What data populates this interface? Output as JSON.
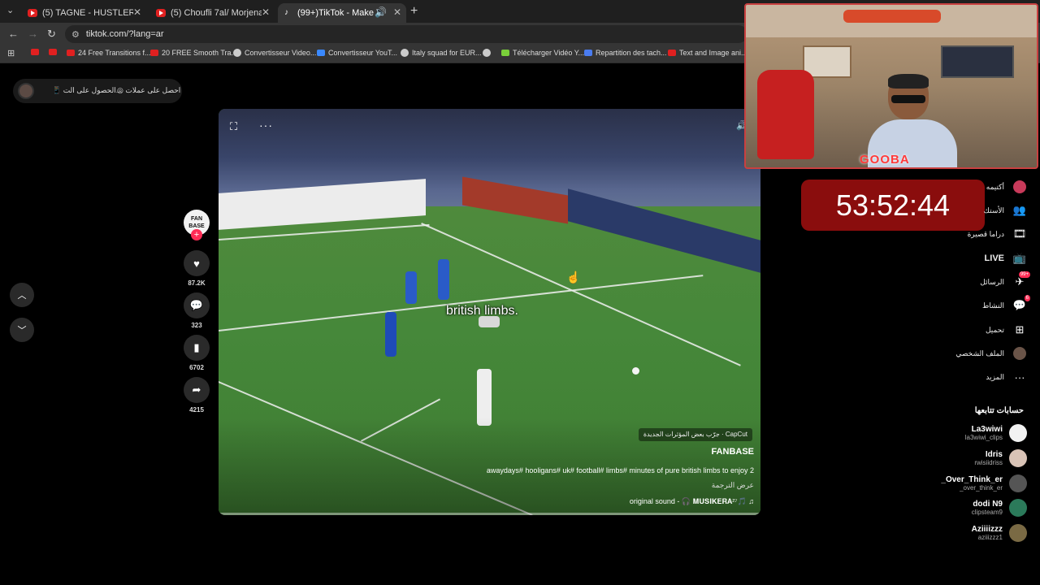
{
  "browser": {
    "tabs": [
      {
        "title": "(5) TAGNE - HUSTLER ft. A.L.A (",
        "icon": "youtube-icon"
      },
      {
        "title": "(5) Choufli 7al/ Morjena - 7obb",
        "icon": "youtube-icon"
      },
      {
        "title": "(99+)TikTok - Make Your Da",
        "icon": "tiktok-icon",
        "active": true
      }
    ],
    "url": "tiktok.com/?lang=ar",
    "bookmarks": [
      {
        "label": "",
        "icon": "youtube-icon"
      },
      {
        "label": "",
        "icon": "youtube-icon"
      },
      {
        "label": "24 Free Transitions f...",
        "icon": "youtube-icon"
      },
      {
        "label": "20 FREE Smooth Tra...",
        "icon": "youtube-icon"
      },
      {
        "label": "Convertisseur Video...",
        "icon": "globe-icon"
      },
      {
        "label": "Convertisseur YouT...",
        "icon": "converter-icon"
      },
      {
        "label": "Italy squad for EUR...",
        "icon": "globe-icon"
      },
      {
        "label": "",
        "icon": "globe-icon"
      },
      {
        "label": "Télécharger Vidéo Y...",
        "icon": "download-icon"
      },
      {
        "label": "Repartition des tach...",
        "icon": "docs-icon"
      },
      {
        "label": "Text and Image ani...",
        "icon": "youtube-icon"
      }
    ]
  },
  "tiktok": {
    "pill": {
      "get_app": "الحصول على الت...",
      "get_coins": "احصل على عملات"
    },
    "video": {
      "caption": "british limbs.",
      "capcut": "CapCut · جرّب بعض المؤثرات الجديدة",
      "author": "FANBASE",
      "description": "awaydays# hooligans# uk# football# limbs# minutes of pure british limbs to enjoy 2",
      "translate": "عرض الترجمة",
      "sound": "original sound - 🎧 𝐌𝐔𝐒𝐈𝐊𝐄𝐑𝐀²⁷🎵 ♫"
    },
    "actions": {
      "avatar_text": "FAN BASE",
      "likes": "87.2K",
      "comments": "323",
      "saves": "6702",
      "shares": "4215"
    },
    "sidebar": [
      {
        "label": "أكتيمه",
        "icon": "avatar-icon"
      },
      {
        "label": "الأستك",
        "icon": "users-icon"
      },
      {
        "label": "دراما قصيرة",
        "icon": "film-icon"
      },
      {
        "label": "LIVE",
        "icon": "live-icon",
        "bold": true
      },
      {
        "label": "الرسائل",
        "icon": "messages-icon",
        "badge": "99+"
      },
      {
        "label": "النشاط",
        "icon": "activity-icon",
        "badge": "6"
      },
      {
        "label": "تحميل",
        "icon": "upload-icon"
      },
      {
        "label": "الملف الشخصي",
        "icon": "profile-icon"
      },
      {
        "label": "المزيد",
        "icon": "more-icon"
      }
    ],
    "following_title": "حسابات تتابعها",
    "following": [
      {
        "name": "La3wiwi",
        "handle": "la3wiwi_clips",
        "color": "#f2f2f2"
      },
      {
        "name": "Idris",
        "handle": "rwisiidriss",
        "color": "#d9c3b6"
      },
      {
        "name": "_Over_Think_er",
        "handle": "_over_think_er",
        "color": "#555555"
      },
      {
        "name": "dodi N9",
        "handle": "clipsteam9",
        "color": "#2b7a5a"
      },
      {
        "name": "Aziiiizzz",
        "handle": "aziiizzz1",
        "color": "#7a6a44"
      }
    ]
  },
  "stream": {
    "timer": "53:52:44",
    "cam_logo": "GOOBA"
  },
  "colors": {
    "accent": "#fe2c55",
    "timer_bg": "#8a0d0d"
  }
}
